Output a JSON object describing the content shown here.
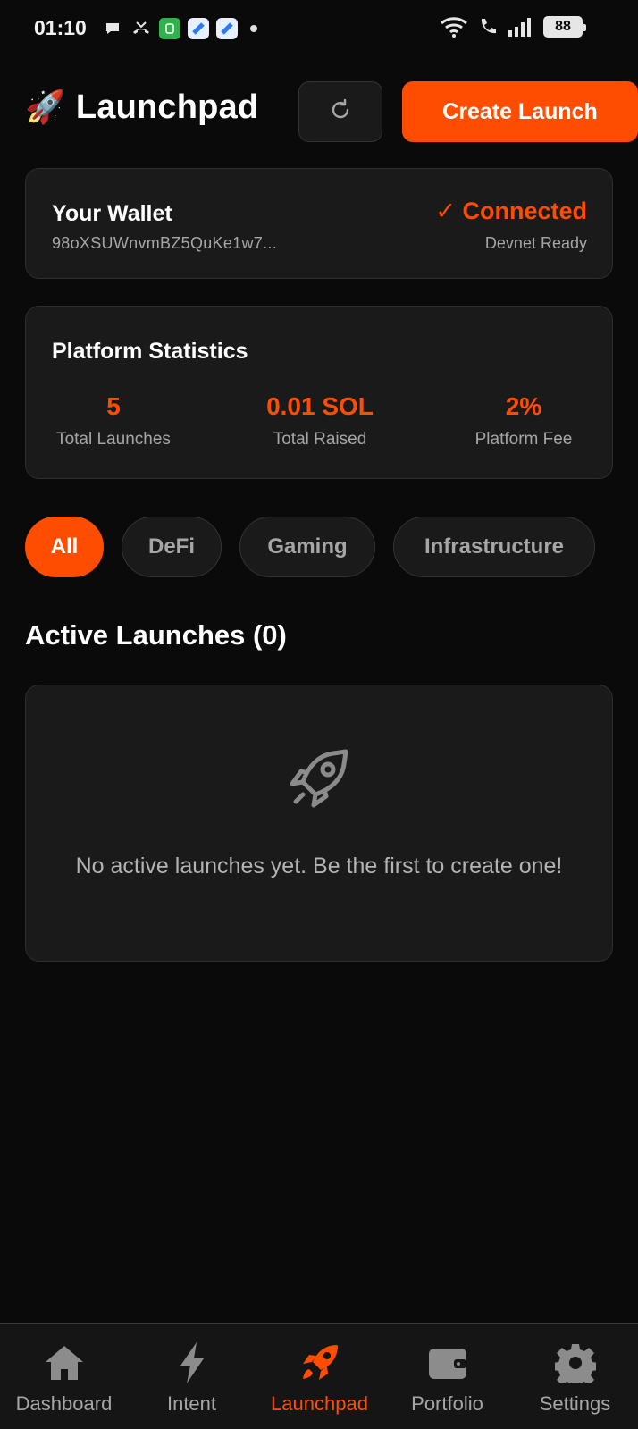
{
  "status_bar": {
    "time": "01:10",
    "battery": "88",
    "icons": [
      "chat-bubble-icon",
      "missed-call-icon",
      "app-green-icon",
      "app-blue-icon",
      "app-blue-icon",
      "dot-icon",
      "wifi-icon",
      "wifi-call-icon",
      "signal-icon",
      "battery-icon"
    ]
  },
  "header": {
    "emoji": "🚀",
    "title": "Launchpad",
    "refresh_icon": "refresh-icon",
    "create_label": "Create Launch"
  },
  "wallet": {
    "title": "Your Wallet",
    "address": "98oXSUWnvmBZ5QuKe1w7...",
    "status": "✓ Connected",
    "network": "Devnet Ready"
  },
  "stats": {
    "title": "Platform Statistics",
    "items": [
      {
        "value": "5",
        "label": "Total Launches"
      },
      {
        "value": "0.01 SOL",
        "label": "Total Raised"
      },
      {
        "value": "2%",
        "label": "Platform Fee"
      }
    ]
  },
  "filters": {
    "items": [
      "All",
      "DeFi",
      "Gaming",
      "Infrastructure"
    ],
    "selected": "All"
  },
  "launches": {
    "title": "Active Launches (0)",
    "empty_icon": "rocket-outline-icon",
    "empty_text": "No active launches yet. Be the first to create one!"
  },
  "nav": {
    "items": [
      {
        "label": "Dashboard",
        "icon": "home-icon"
      },
      {
        "label": "Intent",
        "icon": "lightning-icon"
      },
      {
        "label": "Launchpad",
        "icon": "rocket-icon"
      },
      {
        "label": "Portfolio",
        "icon": "wallet-icon"
      },
      {
        "label": "Settings",
        "icon": "gear-icon"
      }
    ],
    "active": "Launchpad"
  },
  "colors": {
    "accent": "#ff4d00",
    "background": "#0a0a0a",
    "card": "#1a1a1a",
    "muted_text": "#a6a6a6"
  }
}
